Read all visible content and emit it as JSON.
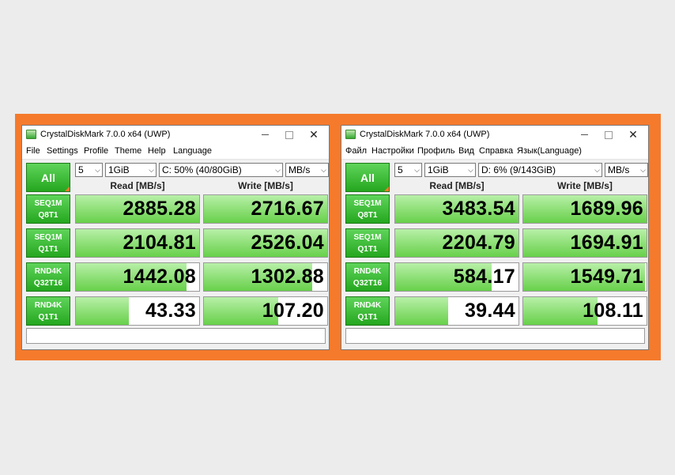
{
  "colors": {
    "frame": "#f57a2c",
    "accent_green": "#25a71f",
    "background": "#ececec"
  },
  "windows": [
    {
      "title": "CrystalDiskMark 7.0.0 x64 (UWP)",
      "menu": [
        "File",
        "Settings",
        "Profile",
        "Theme",
        "Help",
        "Language"
      ],
      "all_label": "All",
      "count": "5",
      "size": "1GiB",
      "drive": "C: 50% (40/80GiB)",
      "unit": "MB/s",
      "read_header": "Read [MB/s]",
      "write_header": "Write [MB/s]",
      "rows": [
        {
          "line1": "SEQ1M",
          "line2": "Q8T1",
          "read": "2885.28",
          "write": "2716.67",
          "read_fill": 1.0,
          "write_fill": 1.0
        },
        {
          "line1": "SEQ1M",
          "line2": "Q1T1",
          "read": "2104.81",
          "write": "2526.04",
          "read_fill": 1.0,
          "write_fill": 1.0
        },
        {
          "line1": "RND4K",
          "line2": "Q32T16",
          "read": "1442.08",
          "write": "1302.88",
          "read_fill": 0.9,
          "write_fill": 0.88
        },
        {
          "line1": "RND4K",
          "line2": "Q1T1",
          "read": "43.33",
          "write": "107.20",
          "read_fill": 0.43,
          "write_fill": 0.6
        }
      ]
    },
    {
      "title": "CrystalDiskMark 7.0.0 x64 (UWP)",
      "menu": [
        "Файл",
        "Настройки",
        "Профиль",
        "Вид",
        "Справка",
        "Язык(Language)"
      ],
      "all_label": "All",
      "count": "5",
      "size": "1GiB",
      "drive": "D: 6% (9/143GiB)",
      "unit": "MB/s",
      "read_header": "Read [MB/s]",
      "write_header": "Write [MB/s]",
      "rows": [
        {
          "line1": "SEQ1M",
          "line2": "Q8T1",
          "read": "3483.54",
          "write": "1689.96",
          "read_fill": 1.0,
          "write_fill": 1.0
        },
        {
          "line1": "SEQ1M",
          "line2": "Q1T1",
          "read": "2204.79",
          "write": "1694.91",
          "read_fill": 1.0,
          "write_fill": 1.0
        },
        {
          "line1": "RND4K",
          "line2": "Q32T16",
          "read": "584.17",
          "write": "1549.71",
          "read_fill": 0.78,
          "write_fill": 0.99
        },
        {
          "line1": "RND4K",
          "line2": "Q1T1",
          "read": "39.44",
          "write": "108.11",
          "read_fill": 0.43,
          "write_fill": 0.6
        }
      ]
    }
  ]
}
